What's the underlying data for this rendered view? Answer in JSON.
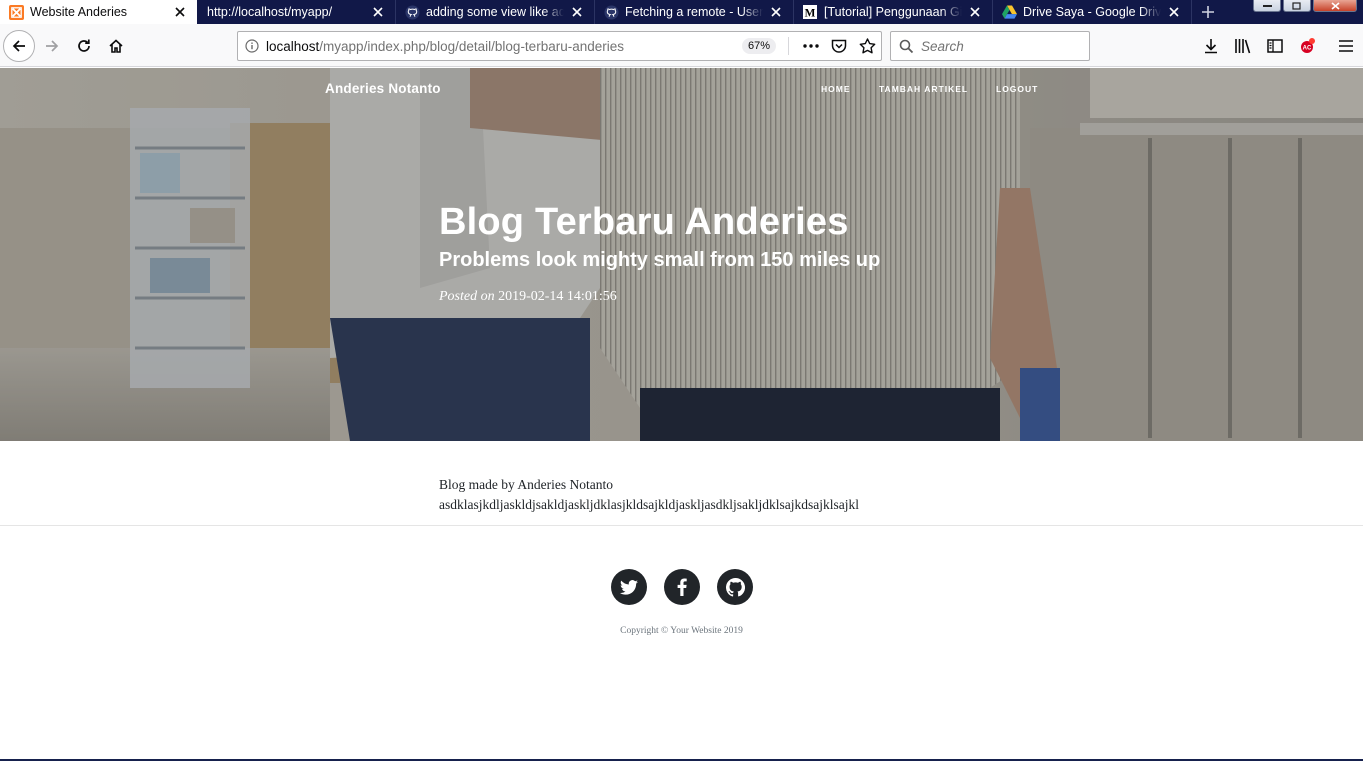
{
  "tabs": [
    {
      "title": "Website Anderies",
      "active": true,
      "icon": "xampp-icon"
    },
    {
      "title": "http://localhost/myapp/",
      "active": false,
      "icon": "none"
    },
    {
      "title": "adding some view like add",
      "active": false,
      "icon": "github-icon"
    },
    {
      "title": "Fetching a remote - User D",
      "active": false,
      "icon": "github-icon"
    },
    {
      "title": "[Tutorial] Penggunaan Git",
      "active": false,
      "icon": "medium-icon"
    },
    {
      "title": "Drive Saya - Google Drive",
      "active": false,
      "icon": "google-drive-icon"
    }
  ],
  "navbar": {
    "url_host": "localhost",
    "url_rest": "/myapp/index.php/blog/detail/blog-terbaru-anderies",
    "zoom": "67%",
    "search_placeholder": "Search"
  },
  "site": {
    "brand": "Anderies Notanto",
    "menu": [
      "HOME",
      "TAMBAH ARTIKEL",
      "LOGOUT"
    ]
  },
  "post": {
    "title": "Blog Terbaru Anderies",
    "subtitle": "Problems look mighty small from 150 miles up",
    "meta_label": "Posted on",
    "meta_date": "2019-02-14 14:01:56",
    "body_line1": "Blog made by Anderies Notanto",
    "body_line2": "asdklasjkdljaskldjsakldjaskljdklasjkldsajkldjaskljasdkljsakljdklsajkdsajklsajkl"
  },
  "footer": {
    "socials": [
      "twitter-icon",
      "facebook-icon",
      "github-icon"
    ],
    "copyright": "Copyright © Your Website 2019"
  },
  "colors": {
    "tab_strip": "#111848",
    "footer_icon_bg": "#212529"
  }
}
